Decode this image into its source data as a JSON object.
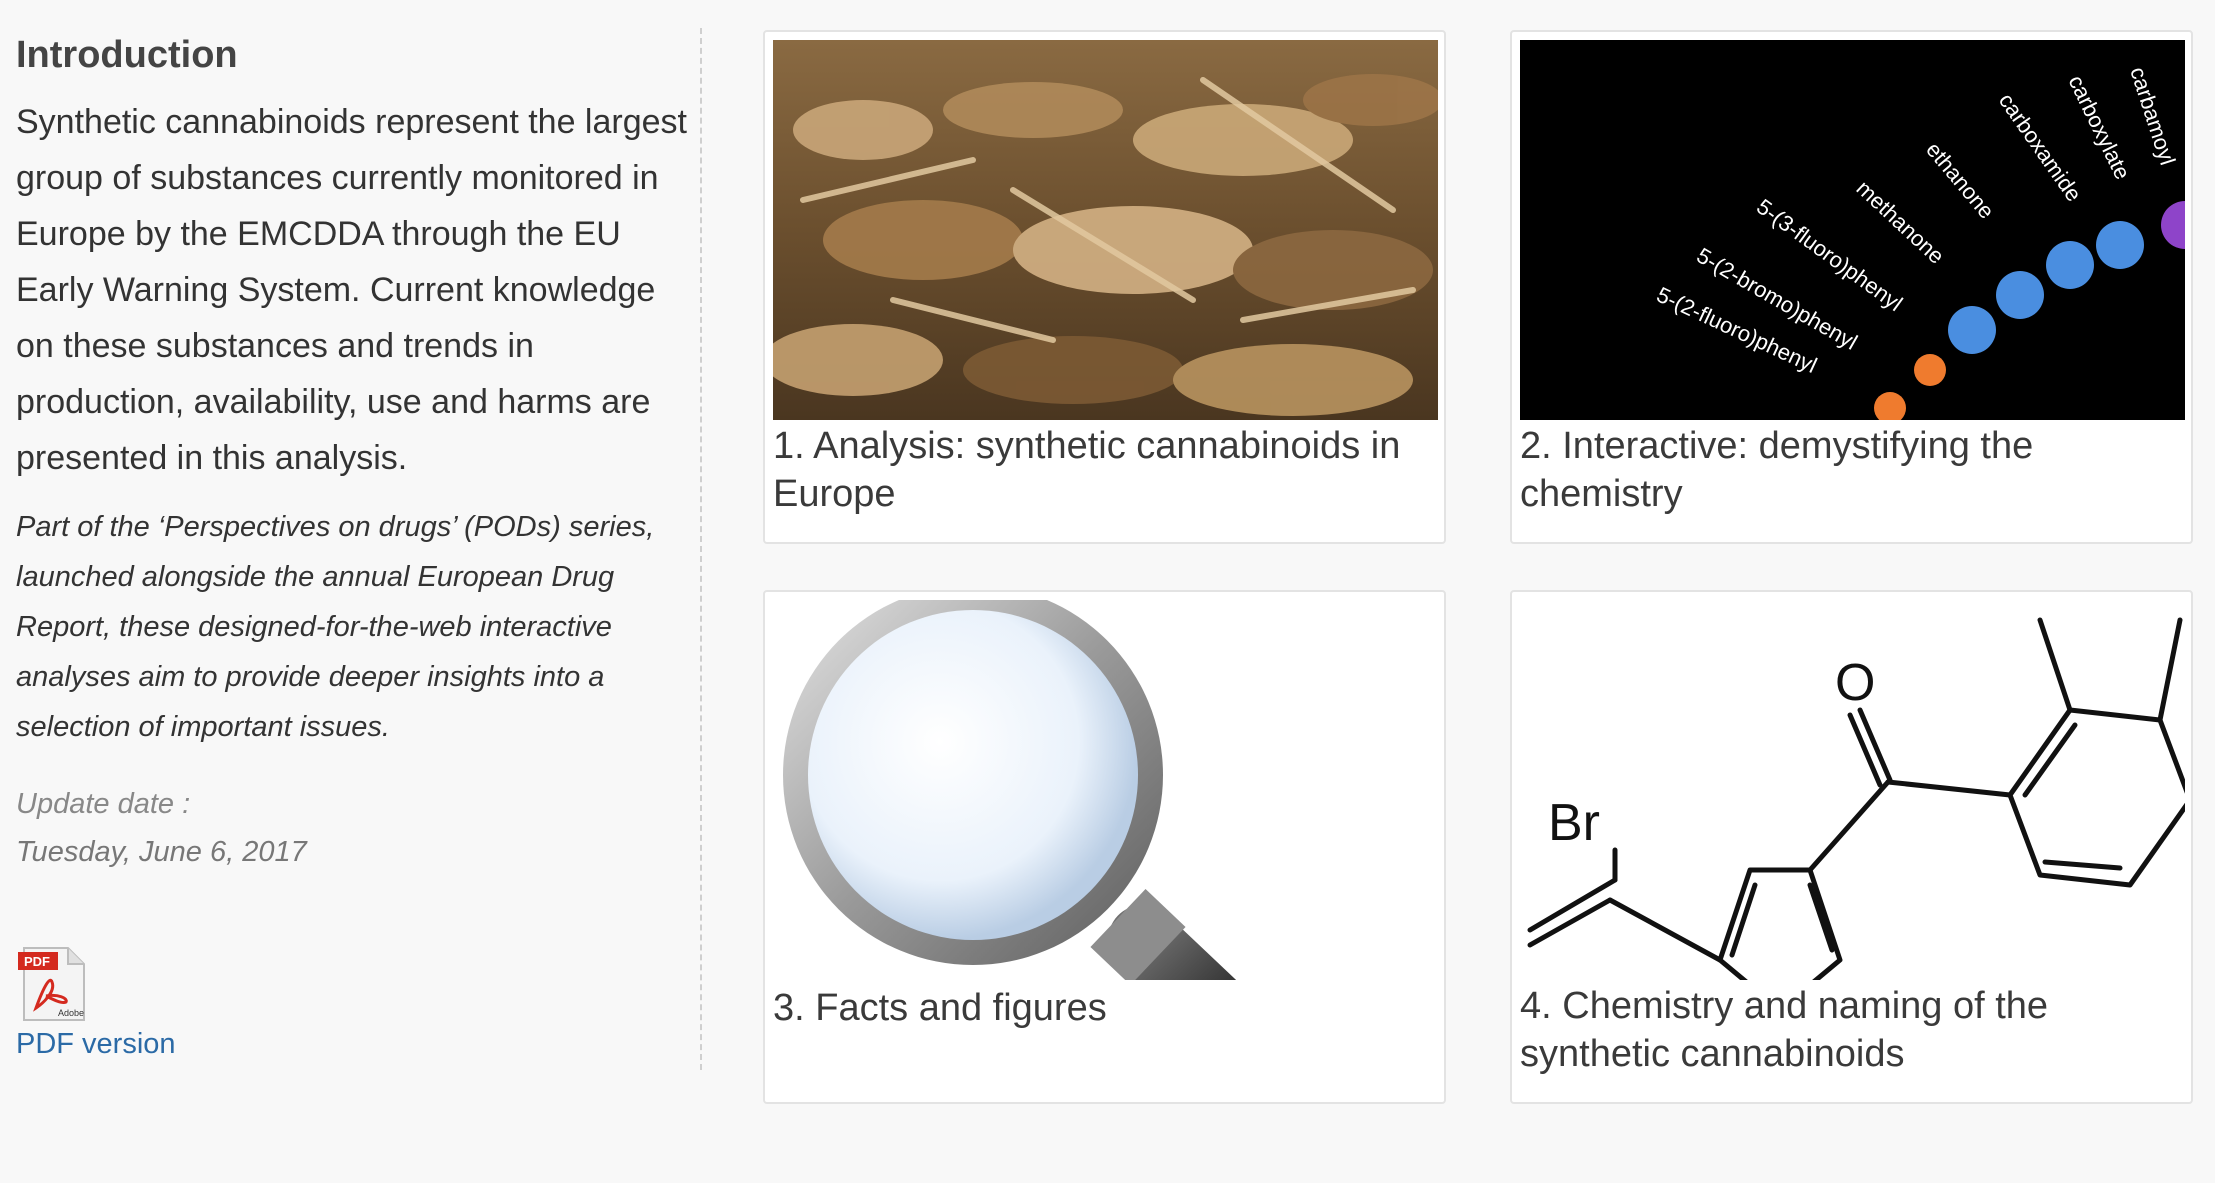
{
  "sidebar": {
    "title": "Introduction",
    "intro": "Synthetic cannabinoids represent the largest group of substances currently monitored in Europe by the EMCDDA through the EU Early Warning System. Current knowledge on these substances and trends in production, availability, use and harms are presented in this analysis.",
    "series": "Part of the ‘Perspectives on drugs’ (PODs) series, launched alongside the annual European Drug Report, these designed-for-the-web interactive analyses aim to provide deeper insights into a selection of important issues.",
    "update_label": "Update date :",
    "update_date": "Tuesday, June 6, 2017",
    "pdf_link": "PDF version",
    "pdf_icon_labels": {
      "top": "PDF",
      "bottom": "Adobe"
    }
  },
  "cards": [
    {
      "caption": "1. Analysis: synthetic cannabinoids in Europe",
      "icon": "dried-herb-photo"
    },
    {
      "caption": "2. Interactive: demystifying the chemistry",
      "icon": "chemistry-labels-graphic",
      "labels": [
        "carbamoyl",
        "carboxylate",
        "carboxamide",
        "ethanone",
        "methanone",
        "5-(3-fluoro)phenyl",
        "5-(2-bromo)phenyl",
        "5-(2-fluoro)phenyl"
      ]
    },
    {
      "caption": "3. Facts and figures",
      "icon": "magnifying-glass-icon"
    },
    {
      "caption": "4. Chemistry and naming of the synthetic cannabinoids",
      "icon": "chemical-structure-graphic",
      "atoms": [
        "O",
        "Br"
      ]
    }
  ],
  "colors": {
    "link": "#2b6aa6",
    "background": "#f8f8f8",
    "pdf_red": "#d42a1f"
  }
}
